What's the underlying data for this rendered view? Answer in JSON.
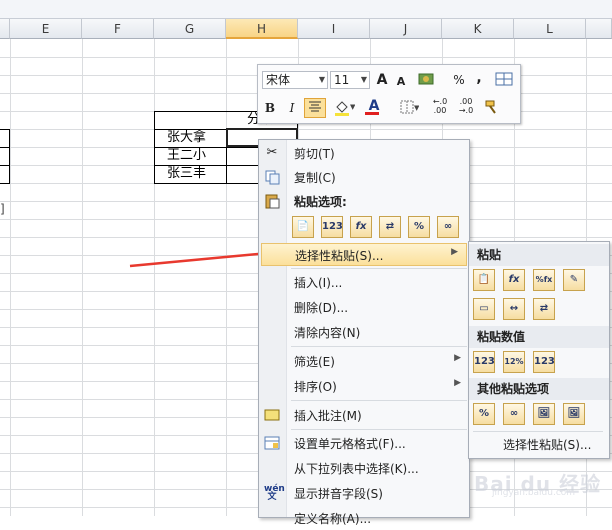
{
  "sheet": {
    "columns": [
      "E",
      "F",
      "G",
      "H",
      "I",
      "J",
      "K",
      "L"
    ],
    "selected_column": "H",
    "header_text": "分数",
    "names": [
      "张大拿",
      "王二小",
      "张三丰"
    ]
  },
  "mini_toolbar": {
    "font_name": "宋体",
    "font_size": "11",
    "grow_font": "A",
    "shrink_font": "A",
    "percent": "%",
    "comma": ",",
    "bold": "B",
    "italic": "I",
    "font_color_letter": "A",
    "inc_decimal": "←.0 .00",
    "dec_decimal": ".00 →.0"
  },
  "context_menu": {
    "items": [
      {
        "label": "剪切(T)",
        "icon": "scissors-icon"
      },
      {
        "label": "复制(C)",
        "icon": "copy-icon"
      },
      {
        "label": "粘贴选项:",
        "icon": "paste-icon"
      },
      {
        "label": "选择性粘贴(S)...",
        "icon": "",
        "submenu": true
      },
      {
        "label": "插入(I)..."
      },
      {
        "label": "删除(D)..."
      },
      {
        "label": "清除内容(N)"
      },
      {
        "label": "筛选(E)",
        "submenu": true
      },
      {
        "label": "排序(O)",
        "submenu": true
      },
      {
        "label": "插入批注(M)",
        "icon": "comment-icon"
      },
      {
        "label": "设置单元格格式(F)...",
        "icon": "format-cells-icon"
      },
      {
        "label": "从下拉列表中选择(K)..."
      },
      {
        "label": "显示拼音字段(S)",
        "icon": "phonetic-icon"
      },
      {
        "label": "定义名称(A)..."
      }
    ],
    "paste_icons": [
      "📄",
      "123",
      "fx",
      "⇄",
      "%",
      "∞"
    ]
  },
  "submenu": {
    "section_paste": "粘贴",
    "section_values": "粘贴数值",
    "section_other": "其他粘贴选项",
    "paste_special": "选择性粘贴(S)...",
    "paste_row1": [
      "📋",
      "fx",
      "%fx",
      "✎"
    ],
    "paste_row2": [
      "▭",
      "↔",
      "⇄"
    ],
    "values_row": [
      "123",
      "12%",
      "123"
    ],
    "other_row": [
      "%",
      "∞",
      "🖼",
      "🖼"
    ]
  },
  "watermark": {
    "text": "Bai du 经验",
    "sub": "jingyan.baidu.com"
  },
  "colors": {
    "highlight": "#fbe09b",
    "arrow": "#e8392e"
  }
}
